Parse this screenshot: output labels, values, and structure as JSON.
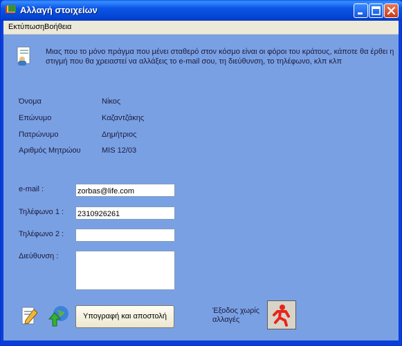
{
  "window": {
    "title": "Αλλαγή στοιχείων"
  },
  "menu": {
    "items": [
      "Εκτύπωση",
      "Βοήθεια"
    ]
  },
  "info": {
    "text": "Μιας που το μόνο πράγμα που μένει σταθερό στον κόσμο είναι οι φόροι του κράτους, κάποτε θα έρθει η στιγμή που θα χρειαστεί να αλλάξεις το e-mail σου, τη διεύθυνση, το τηλέφωνο,  κλπ κλπ"
  },
  "details": [
    {
      "label": "Όνομα",
      "value": "Νίκος"
    },
    {
      "label": "Επώνυμο",
      "value": "Καζαντζάκης"
    },
    {
      "label": "Πατρώνυμο",
      "value": "Δημήτριος"
    },
    {
      "label": "Αριθμός Μητρώου",
      "value": "MIS 12/03"
    }
  ],
  "form": {
    "email": {
      "label": "e-mail :",
      "value": "zorbas@life.com"
    },
    "phone1": {
      "label": "Τηλέφωνο 1 :",
      "value": "2310926261"
    },
    "phone2": {
      "label": "Τηλέφωνο 2 :",
      "value": ""
    },
    "address": {
      "label": "Διεύθυνση :",
      "value": ""
    }
  },
  "actions": {
    "sign_send": "Υπογραφή και αποστολή",
    "exit_label": "Έξοδος χωρίς αλλαγές"
  },
  "icons": {
    "info": "contact-card-icon",
    "edit": "document-pencil-icon",
    "web": "globe-upload-icon",
    "exit": "running-man-icon"
  },
  "colors": {
    "client_bg": "#7aa0e4",
    "titlebar": "#0a55e6",
    "exit_icon": "#e8231a"
  }
}
